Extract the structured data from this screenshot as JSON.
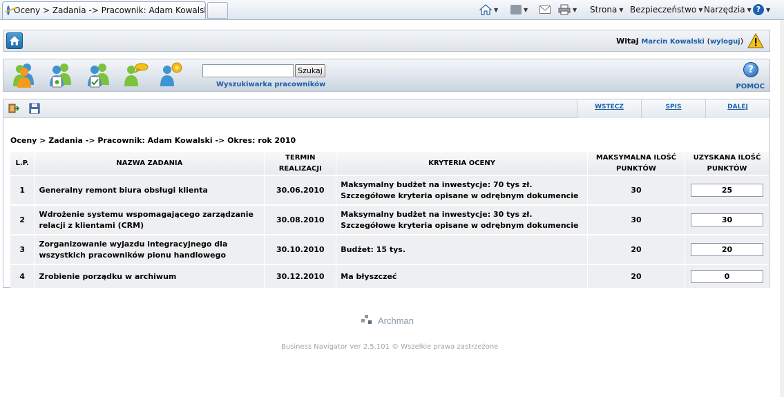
{
  "browser": {
    "tab_title": "Oceny > Zadania -> Pracownik: Adam Kowalski -...",
    "menu": {
      "strona": "Strona",
      "bezpieczenstwo": "Bezpieczeństwo",
      "narzedzia": "Narzędzia"
    }
  },
  "header": {
    "welcome_label": "Witaj",
    "user_name": "Marcin Kowalski",
    "logout_label": "wyloguj",
    "open_paren": "(",
    "close_paren": ")"
  },
  "search": {
    "value": "",
    "button_label": "Szukaj",
    "caption": "Wyszukiwarka pracowników"
  },
  "help": {
    "icon_text": "?",
    "label": "POMOC"
  },
  "nav": {
    "back": "WSTECZ",
    "index": "SPIS",
    "next": "DALEJ"
  },
  "breadcrumb": "Oceny > Zadania -> Pracownik: Adam Kowalski -> Okres: rok 2010",
  "table": {
    "headers": {
      "lp": "L.P.",
      "name": "NAZWA ZADANIA",
      "deadline_1": "TERMIN",
      "deadline_2": "REALIZACJI",
      "criteria": "KRYTERIA OCENY",
      "max_1": "MAKSYMALNA ILOŚĆ",
      "max_2": "PUNKTÓW",
      "got_1": "UZYSKANA ILOŚĆ",
      "got_2": "PUNKTÓW"
    },
    "rows": [
      {
        "lp": "1",
        "name": "Generalny remont biura obsługi klienta",
        "deadline": "30.06.2010",
        "criteria": "Maksymalny budżet na inwestycje: 70 tys zł. Szczegółowe kryteria opisane w odrębnym dokumencie",
        "max": "30",
        "got": "25"
      },
      {
        "lp": "2",
        "name": "Wdrożenie systemu wspomagającego zarządzanie relacji z klientami (CRM)",
        "deadline": "30.08.2010",
        "criteria": "Maksymalny budżet na inwestycje: 30 tys zł. Szczegółowe kryteria opisane w odrębnym dokumencie",
        "max": "30",
        "got": "30"
      },
      {
        "lp": "3",
        "name": "Zorganizowanie wyjazdu integracyjnego dla wszystkich pracowników pionu handlowego",
        "deadline": "30.10.2010",
        "criteria": "Budżet: 15 tys.",
        "max": "20",
        "got": "20"
      },
      {
        "lp": "4",
        "name": "Zrobienie porządku w archiwum",
        "deadline": "30.12.2010",
        "criteria": "Ma błyszczeć",
        "max": "20",
        "got": "0"
      }
    ]
  },
  "footer": {
    "brand": "Archman",
    "copyright": "Business Navigator ver 2.5.101 © Wszelkie prawa zastrzeżone"
  },
  "colors": {
    "link": "#1c5ea8",
    "row_bg": "#eeeff1"
  }
}
